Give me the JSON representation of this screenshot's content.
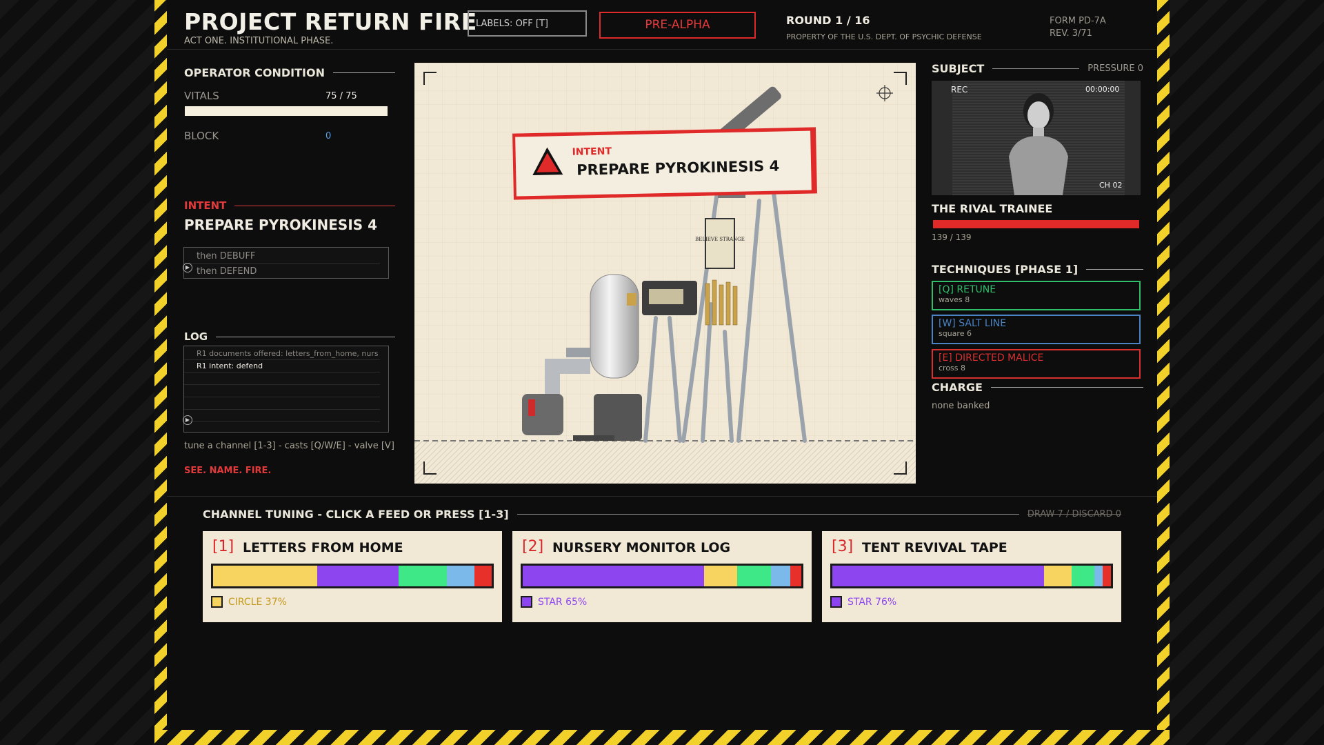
{
  "header": {
    "title": "PROJECT RETURN FIRE",
    "subtitle": "ACT ONE. INSTITUTIONAL PHASE.",
    "labels_toggle": "LABELS: OFF [T]",
    "build_badge": "PRE-ALPHA",
    "round": "ROUND 1 / 16",
    "property": "PROPERTY OF THE U.S. DEPT. OF PSYCHIC DEFENSE",
    "form": "FORM PD-7A",
    "rev": "REV. 3/71"
  },
  "operator": {
    "heading": "OPERATOR CONDITION",
    "vitals_label": "VITALS",
    "vitals_value": "75 / 75",
    "vitals_fraction": 1.0,
    "block_label": "BLOCK",
    "block_value": "0"
  },
  "intent_panel": {
    "heading": "INTENT",
    "action": "PREPARE PYROKINESIS 4",
    "queue": [
      "then DEBUFF",
      "then DEFEND"
    ]
  },
  "log": {
    "heading": "LOG",
    "lines": [
      "R1 documents offered: letters_from_home, nurs",
      "R1 intent: defend"
    ],
    "hint": "tune a channel [1-3] - casts [Q/W/E] - valve [V]",
    "motto": "SEE. NAME. FIRE."
  },
  "stage": {
    "intent_label": "INTENT",
    "intent_action": "PREPARE PYROKINESIS 4",
    "poster_text": "BELIEVE STRANGE"
  },
  "subject": {
    "heading": "SUBJECT",
    "pressure": "PRESSURE 0",
    "rec": "REC",
    "timecode": "00:00:00",
    "channel": "CH 02",
    "name": "THE RIVAL TRAINEE",
    "hp_value": "139 / 139",
    "hp_fraction": 1.0
  },
  "techniques": {
    "heading": "TECHNIQUES  [PHASE 1]",
    "items": [
      {
        "key": "[Q] RETUNE",
        "detail": "waves 8",
        "color": "#2fbf6a"
      },
      {
        "key": "[W] SALT LINE",
        "detail": "square 6",
        "color": "#4a84c4"
      },
      {
        "key": "[E] DIRECTED MALICE",
        "detail": "cross 8",
        "color": "#d93030"
      }
    ]
  },
  "charge": {
    "heading": "CHARGE",
    "value": "none banked"
  },
  "tuning": {
    "heading": "CHANNEL TUNING - CLICK A FEED OR PRESS [1-3]",
    "draw": "DRAW 7",
    "discard": "DISCARD 0",
    "separator": "/",
    "feeds": [
      {
        "index": "[1]",
        "name": "LETTERS FROM HOME",
        "dominant": "CIRCLE 37%",
        "dominant_color": "#f7d460",
        "caption_color": "#c49a1a",
        "segments": [
          {
            "color": "#f7d460",
            "pct": 37
          },
          {
            "color": "#8d45f0",
            "pct": 29
          },
          {
            "color": "#3ee886",
            "pct": 17
          },
          {
            "color": "#7ab9ea",
            "pct": 10
          },
          {
            "color": "#e8302a",
            "pct": 6
          }
        ]
      },
      {
        "index": "[2]",
        "name": "NURSERY MONITOR LOG",
        "dominant": "STAR 65%",
        "dominant_color": "#8d45f0",
        "caption_color": "#8d45f0",
        "segments": [
          {
            "color": "#8d45f0",
            "pct": 65
          },
          {
            "color": "#f7d460",
            "pct": 12
          },
          {
            "color": "#3ee886",
            "pct": 12
          },
          {
            "color": "#7ab9ea",
            "pct": 7
          },
          {
            "color": "#e8302a",
            "pct": 4
          }
        ]
      },
      {
        "index": "[3]",
        "name": "TENT REVIVAL TAPE",
        "dominant": "STAR 76%",
        "dominant_color": "#8d45f0",
        "caption_color": "#8d45f0",
        "segments": [
          {
            "color": "#8d45f0",
            "pct": 76
          },
          {
            "color": "#f7d460",
            "pct": 10
          },
          {
            "color": "#3ee886",
            "pct": 8
          },
          {
            "color": "#7ab9ea",
            "pct": 3
          },
          {
            "color": "#e8302a",
            "pct": 3
          }
        ]
      }
    ]
  }
}
